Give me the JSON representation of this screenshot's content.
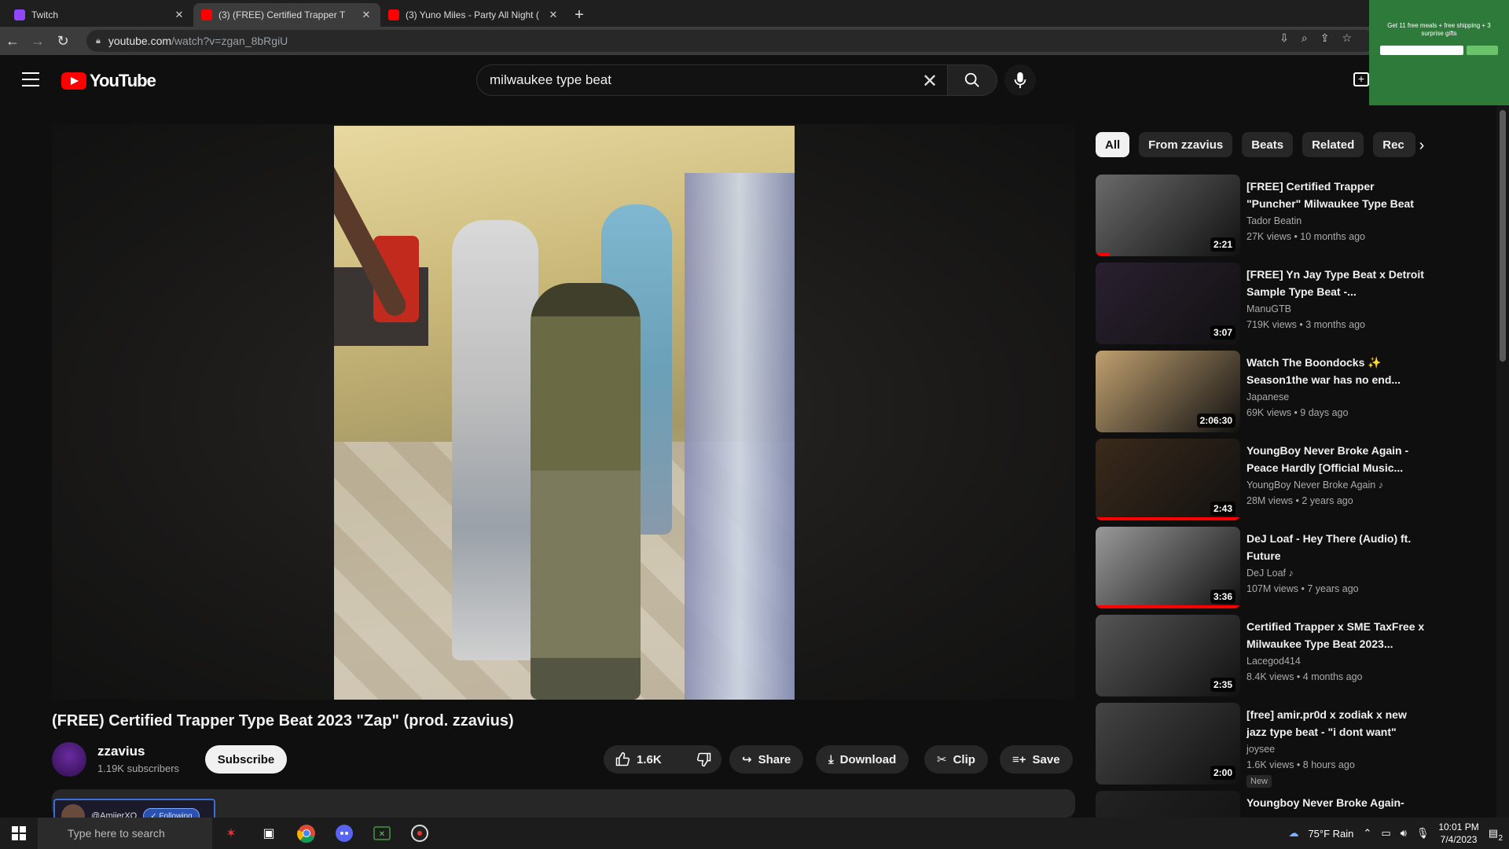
{
  "browser": {
    "tabs": [
      {
        "title": "Twitch",
        "active": false
      },
      {
        "title": "(3) (FREE) Certified Trapper T",
        "active": true
      },
      {
        "title": "(3) Yuno Miles - Party All Night (",
        "active": false
      }
    ],
    "url_host": "youtube.com",
    "url_path": "/watch?v=zgan_8bRgiU"
  },
  "ad": {
    "text": "Get 11 free meals + free shipping + 3 surprise gifts"
  },
  "youtube": {
    "logo_text": "YouTube",
    "search_value": "milwaukee type beat"
  },
  "video": {
    "title": "(FREE) Certified Trapper Type Beat 2023 \"Zap\" (prod. zzavius)",
    "channel": "zzavius",
    "subscribers": "1.19K subscribers",
    "subscribe_label": "Subscribe",
    "likes": "1.6K",
    "share_label": "Share",
    "download_label": "Download",
    "clip_label": "Clip",
    "save_label": "Save"
  },
  "twitch_popup": {
    "name": "@AmiierXO",
    "button": "Following"
  },
  "chips": [
    "All",
    "From zzavius",
    "Beats",
    "Related",
    "Rec"
  ],
  "recommendations": [
    {
      "title": "[FREE] Certified Trapper \"Puncher\" Milwaukee Type Beat",
      "channel": "Tador Beatin",
      "meta": "27K views • 10 months ago",
      "duration": "2:21",
      "progress": 0.1,
      "color": "#6a6a6a"
    },
    {
      "title": "[FREE] Yn Jay Type Beat x Detroit Sample Type Beat -...",
      "channel": "ManuGTB",
      "meta": "719K views • 3 months ago",
      "duration": "3:07",
      "progress": 0,
      "color": "#2a2030"
    },
    {
      "title": "Watch The Boondocks ✨ Season1the war has no end...",
      "channel": "Japanese",
      "meta": "69K views • 9 days ago",
      "duration": "2:06:30",
      "progress": 0,
      "color": "#c0a070"
    },
    {
      "title": "YoungBoy Never Broke Again - Peace Hardly [Official Music...",
      "channel": "YoungBoy Never Broke Again ♪",
      "meta": "28M views • 2 years ago",
      "duration": "2:43",
      "progress": 1.0,
      "color": "#3a2a1a"
    },
    {
      "title": "DeJ Loaf - Hey There (Audio) ft. Future",
      "channel": "DeJ Loaf ♪",
      "meta": "107M views • 7 years ago",
      "duration": "3:36",
      "progress": 1.0,
      "color": "#999"
    },
    {
      "title": "Certified Trapper x SME TaxFree x Milwaukee Type Beat 2023...",
      "channel": "Lacegod414",
      "meta": "8.4K views • 4 months ago",
      "duration": "2:35",
      "progress": 0,
      "color": "#555"
    },
    {
      "title": "[free] amir.pr0d x zodiak x new jazz type beat - \"i dont want\"",
      "channel": "joysee",
      "meta": "1.6K views • 8 hours ago",
      "duration": "2:00",
      "progress": 0,
      "color": "#444",
      "badge": "New"
    },
    {
      "title": "Youngboy Never Broke Again-",
      "channel": "",
      "meta": "",
      "duration": "",
      "progress": 0,
      "color": "#222"
    }
  ],
  "taskbar": {
    "search_placeholder": "Type here to search",
    "weather": "75°F  Rain",
    "time": "10:01 PM",
    "date": "7/4/2023",
    "notif_count": "2"
  }
}
